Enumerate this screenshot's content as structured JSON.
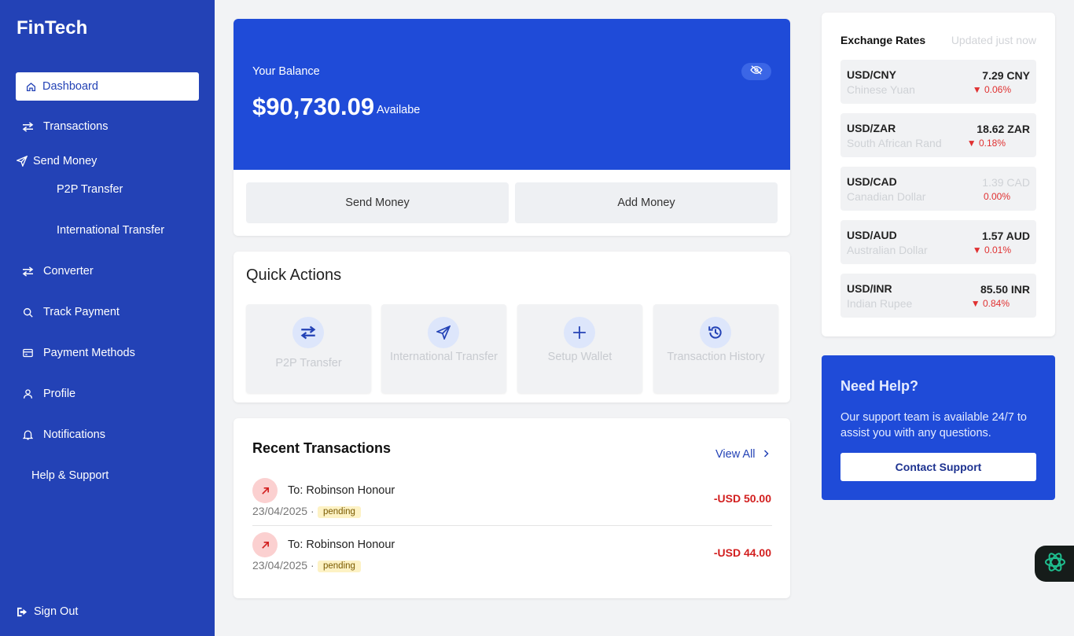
{
  "sidebar": {
    "brand": "FinTech",
    "items": [
      {
        "label": "Dashboard",
        "icon": "home-icon"
      },
      {
        "label": "Transactions",
        "icon": "swap-arrows-icon"
      },
      {
        "label": "Send Money",
        "icon": "send-icon"
      },
      {
        "label": "P2P Transfer"
      },
      {
        "label": "International Transfer"
      },
      {
        "label": "Converter",
        "icon": "swap-arrows-icon"
      },
      {
        "label": "Track Payment",
        "icon": "search-icon"
      },
      {
        "label": "Payment Methods",
        "icon": "card-icon"
      },
      {
        "label": "Profile",
        "icon": "user-icon"
      },
      {
        "label": "Notifications",
        "icon": "bell-icon"
      },
      {
        "label": "Help & Support"
      }
    ],
    "sign_out": "Sign Out"
  },
  "balance": {
    "label": "Your Balance",
    "amount": "$90,730.09",
    "available": "Availabe",
    "send_money": "Send Money",
    "add_money": "Add Money"
  },
  "quick_actions": {
    "title": "Quick Actions",
    "items": [
      {
        "label": "P2P Transfer",
        "icon": "swap-arrows-icon"
      },
      {
        "label": "International Transfer",
        "icon": "send-icon"
      },
      {
        "label": "Setup Wallet",
        "icon": "plus-icon"
      },
      {
        "label": "Transaction History",
        "icon": "history-icon"
      }
    ]
  },
  "recent": {
    "title": "Recent Transactions",
    "view_all": "View All",
    "transactions": [
      {
        "to": "To: Robinson Honour",
        "date": "23/04/2025 ·",
        "status": "pending",
        "amount": "-USD 50.00"
      },
      {
        "to": "To: Robinson Honour",
        "date": "23/04/2025 ·",
        "status": "pending",
        "amount": "-USD 44.00"
      }
    ]
  },
  "exchange": {
    "title": "Exchange Rates",
    "updated": "Updated just now",
    "rates": [
      {
        "pair": "USD/CNY",
        "name": "Chinese Yuan",
        "rate": "7.29 CNY",
        "change": "▼ 0.06%"
      },
      {
        "pair": "USD/ZAR",
        "name": "South African Rand",
        "rate": "18.62 ZAR",
        "change": "▼ 0.18%"
      },
      {
        "pair": "USD/CAD",
        "name": "Canadian Dollar",
        "rate": "1.39 CAD",
        "change": "0.00%"
      },
      {
        "pair": "USD/AUD",
        "name": "Australian Dollar",
        "rate": "1.57 AUD",
        "change": "▼ 0.01%"
      },
      {
        "pair": "USD/INR",
        "name": "Indian Rupee",
        "rate": "85.50 INR",
        "change": "▼ 0.84%"
      }
    ]
  },
  "help": {
    "title": "Need Help?",
    "text": "Our support team is available 24/7 to assist you with any questions.",
    "button": "Contact Support"
  },
  "colors": {
    "sidebar": "#2342b6",
    "primary": "#1f4bd8",
    "negative": "#d21f1f",
    "pending_badge": "#fdf2c4"
  }
}
